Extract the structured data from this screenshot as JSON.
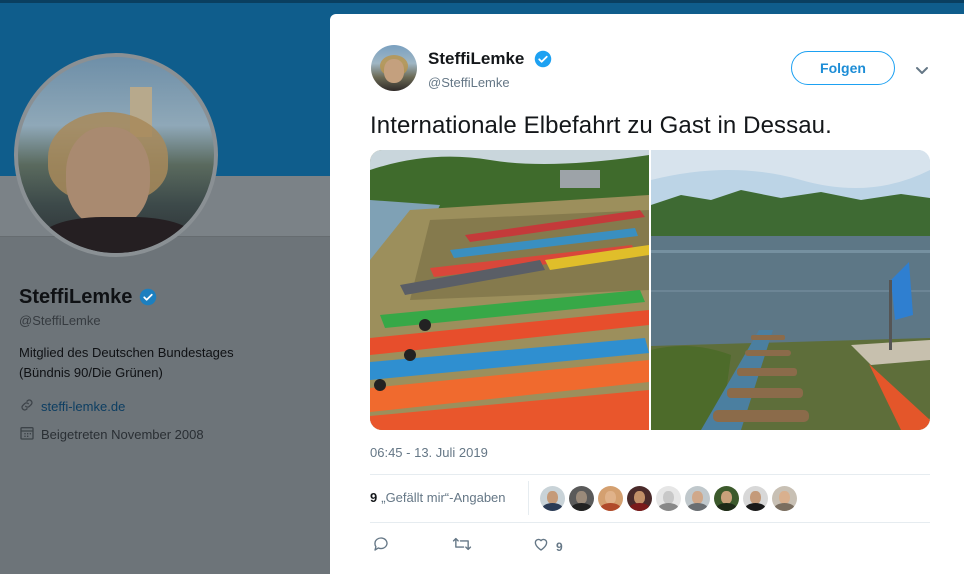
{
  "profile": {
    "name": "SteffiLemke",
    "handle": "@SteffiLemke",
    "bio": "Mitglied des Deutschen Bundestages\n(Bündnis 90/Die Grünen)",
    "website": "steffi-lemke.de",
    "joined": "Beigetreten November 2008"
  },
  "tweet": {
    "author_name": "SteffiLemke",
    "author_handle": "@SteffiLemke",
    "follow_label": "Folgen",
    "text": "Internationale Elbefahrt zu Gast in Dessau.",
    "timestamp": "06:45 - 13. Juli 2019",
    "likes_count": "9",
    "likes_label": "„Gefällt mir“-Angaben",
    "action_like_count": "9"
  },
  "colors": {
    "accent": "#1da1f2",
    "verified": "#1da1f2",
    "banner": "#0f5d8c",
    "overlay_bg": "#6d7479"
  },
  "icons": {
    "verified": "verified-badge-icon",
    "link": "link-icon",
    "calendar": "calendar-icon",
    "caret": "chevron-down-icon",
    "reply": "reply-icon",
    "retweet": "retweet-icon",
    "like": "heart-icon"
  }
}
